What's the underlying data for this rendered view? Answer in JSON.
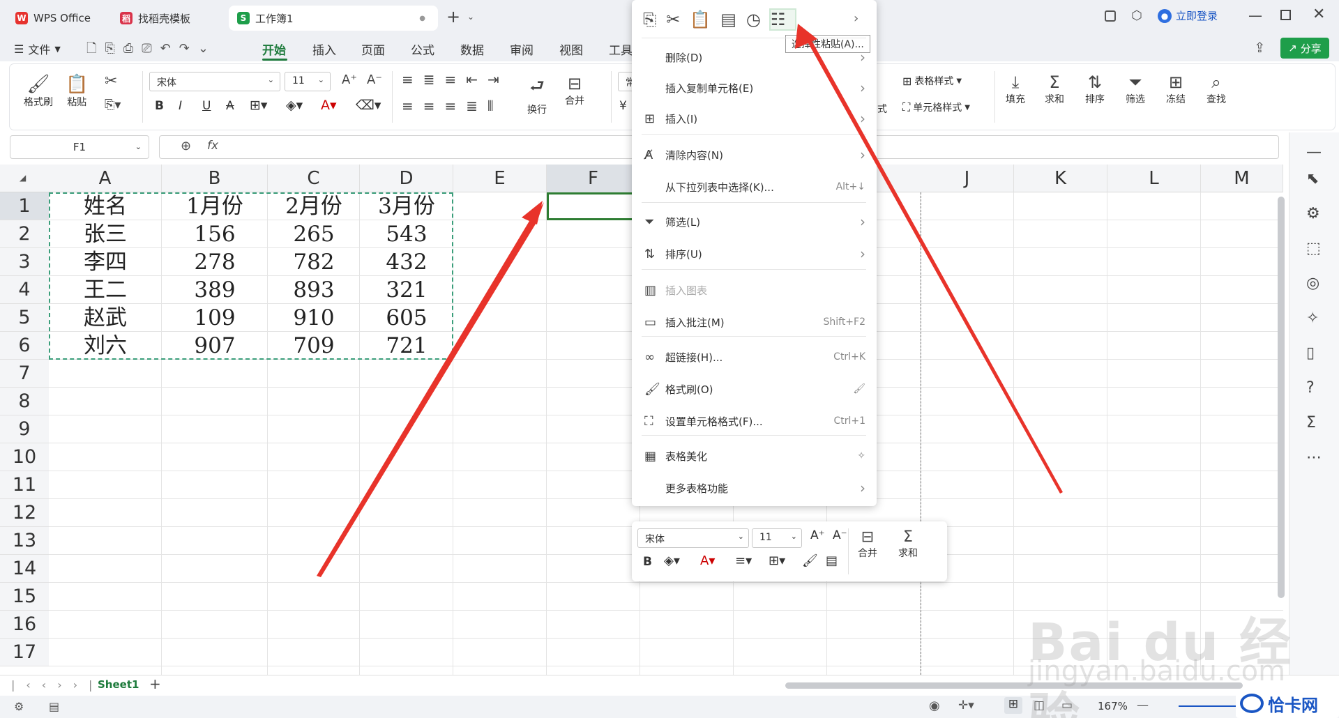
{
  "titlebar": {
    "tabs": [
      {
        "label": "WPS Office",
        "logo": "W",
        "color": "#e6322e"
      },
      {
        "label": "找稻壳模板",
        "logo": "稻",
        "color": "#d9334a"
      },
      {
        "label": "工作簿1",
        "logo": "S",
        "color": "#1e9e4a"
      }
    ],
    "dot": "●",
    "new_tab": "+",
    "login": "立即登录",
    "accent": "#1e7b3c"
  },
  "menubar": {
    "file": "文件",
    "items": [
      "开始",
      "插入",
      "页面",
      "公式",
      "数据",
      "审阅",
      "视图",
      "工具"
    ],
    "share": "分享"
  },
  "ribbon": {
    "format_painter": "格式刷",
    "paste": "粘贴",
    "font_name": "宋体",
    "font_size": "11",
    "wrap": "换行",
    "merge": "合并",
    "number_format": "常",
    "table_style": "表格样式",
    "cell_style": "单元格样式",
    "style_partial": "式",
    "fill": "填充",
    "sum": "求和",
    "sort": "排序",
    "filter": "筛选",
    "freeze": "冻结",
    "find": "查找"
  },
  "formula": {
    "name_box": "F1",
    "fx": "fx"
  },
  "sheet": {
    "columns": [
      "A",
      "B",
      "C",
      "D",
      "E",
      "F",
      "J",
      "K",
      "L",
      "M"
    ],
    "rows": [
      "1",
      "2",
      "3",
      "4",
      "5",
      "6",
      "7",
      "8",
      "9",
      "10",
      "11",
      "12",
      "13",
      "14",
      "15",
      "16",
      "17"
    ],
    "data": [
      [
        "姓名",
        "1月份",
        "2月份",
        "3月份"
      ],
      [
        "张三",
        "156",
        "265",
        "543"
      ],
      [
        "李四",
        "278",
        "782",
        "432"
      ],
      [
        "王二",
        "389",
        "893",
        "321"
      ],
      [
        "赵武",
        "109",
        "910",
        "605"
      ],
      [
        "刘六",
        "907",
        "709",
        "721"
      ]
    ],
    "selection_color": "#2e7d32"
  },
  "context_menu": {
    "tooltip": "选择性粘贴(A)...",
    "items": [
      {
        "label": "删除(D)",
        "shortcut": "",
        "arrow": true,
        "icon": ""
      },
      {
        "label": "插入复制单元格(E)",
        "shortcut": "",
        "arrow": true,
        "icon": ""
      },
      {
        "label": "插入(I)",
        "shortcut": "",
        "arrow": true,
        "icon": "insert-icon"
      },
      {
        "label": "清除内容(N)",
        "shortcut": "",
        "arrow": true,
        "icon": "clear-icon"
      },
      {
        "label": "从下拉列表中选择(K)...",
        "shortcut": "Alt+↓",
        "arrow": false,
        "icon": ""
      },
      {
        "label": "筛选(L)",
        "shortcut": "",
        "arrow": true,
        "icon": "filter-icon"
      },
      {
        "label": "排序(U)",
        "shortcut": "",
        "arrow": true,
        "icon": "sort-icon"
      },
      {
        "label": "插入图表",
        "shortcut": "",
        "arrow": false,
        "icon": "chart-icon",
        "disabled": true
      },
      {
        "label": "插入批注(M)",
        "shortcut": "Shift+F2",
        "arrow": false,
        "icon": "comment-icon"
      },
      {
        "label": "超链接(H)...",
        "shortcut": "Ctrl+K",
        "arrow": false,
        "icon": "link-icon"
      },
      {
        "label": "格式刷(O)",
        "shortcut": "",
        "arrow": false,
        "icon": "brush-icon"
      },
      {
        "label": "设置单元格格式(F)...",
        "shortcut": "Ctrl+1",
        "arrow": false,
        "icon": "format-icon"
      },
      {
        "label": "表格美化",
        "shortcut": "",
        "arrow": false,
        "icon": "beautify-icon"
      },
      {
        "label": "更多表格功能",
        "shortcut": "",
        "arrow": true,
        "icon": ""
      }
    ]
  },
  "mini_toolbar": {
    "font_name": "宋体",
    "font_size": "11",
    "merge": "合并",
    "sum": "求和"
  },
  "sheet_tabs": {
    "active": "Sheet1",
    "add": "+"
  },
  "status": {
    "zoom": "167%"
  },
  "watermark": {
    "baidu": "Bai du 经验",
    "url": "jingyan.baidu.com",
    "site": "恰卡网"
  }
}
